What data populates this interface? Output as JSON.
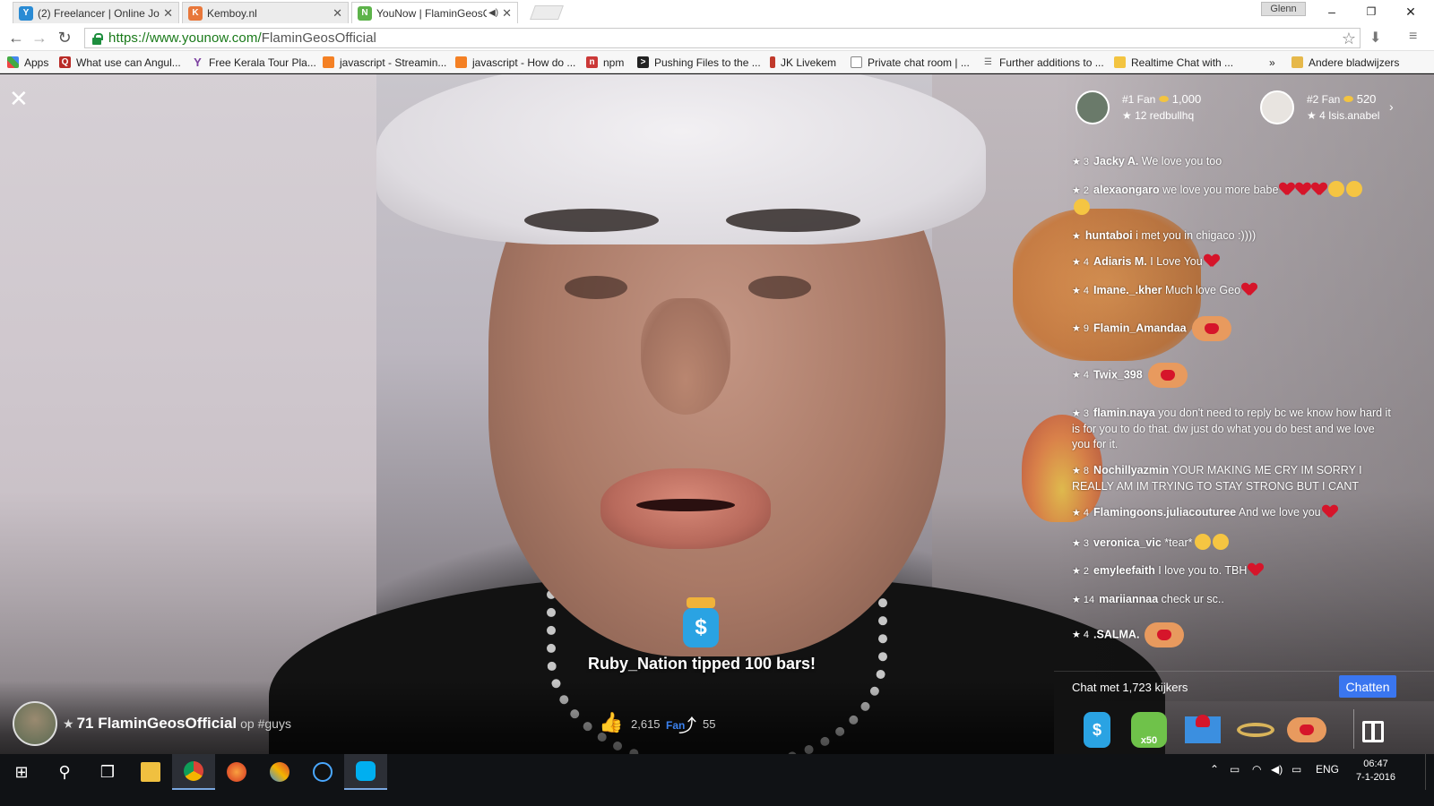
{
  "browser": {
    "tabs": [
      {
        "label": "(2) Freelancer | Online Job",
        "favicon": "freelancer-icon",
        "active": false
      },
      {
        "label": "Kemboy.nl",
        "favicon": "kemboy-icon",
        "active": false
      },
      {
        "label": "YouNow | FlaminGeosO",
        "favicon": "younow-icon",
        "active": true
      }
    ],
    "user_label": "Glenn",
    "window_controls": {
      "minimize": "–",
      "maximize": "❐",
      "close": "✕"
    },
    "url_host": "https://www.younow.com/",
    "url_path": "FlaminGeosOfficial",
    "bookmarks": [
      {
        "label": "Apps",
        "icon": "apps-grid-icon"
      },
      {
        "label": "What use can Angul...",
        "icon": "quora-icon"
      },
      {
        "label": "Free Kerala Tour Pla...",
        "icon": "yahoo-icon"
      },
      {
        "label": "javascript - Streamin...",
        "icon": "stackoverflow-icon"
      },
      {
        "label": "javascript - How do ...",
        "icon": "stackoverflow-icon"
      },
      {
        "label": "npm",
        "icon": "npm-icon"
      },
      {
        "label": "Pushing Files to the ...",
        "icon": "terminal-icon"
      },
      {
        "label": "JK Livekem",
        "icon": "jk-icon"
      },
      {
        "label": "Private chat room | ...",
        "icon": "document-icon"
      },
      {
        "label": "Further additions to ...",
        "icon": "list-icon"
      },
      {
        "label": "Realtime Chat with ...",
        "icon": "folder-page-icon"
      }
    ],
    "bookmarks_overflow": "»",
    "other_bookmarks": "Andere bladwijzers"
  },
  "stream": {
    "close_label": "✕",
    "fans": [
      {
        "rank_label": "#1 Fan",
        "bars": "1,000",
        "level_name": "★ 12 redbullhq"
      },
      {
        "rank_label": "#2 Fan",
        "bars": "520",
        "level_name": "★ 4 Isis.anabel"
      }
    ],
    "chat": [
      {
        "level": "★ 3",
        "user": "Jacky A.",
        "text": " We love you too",
        "extras": ""
      },
      {
        "level": "★ 2",
        "user": "alexaongaro",
        "text": " we love you more babe",
        "extras": "hearts-kiss"
      },
      {
        "level": "★",
        "user": "huntaboi",
        "text": " i met you in chigaco :))))",
        "extras": ""
      },
      {
        "level": "★ 4",
        "user": "Adiaris M.",
        "text": " I Love You",
        "extras": "heart"
      },
      {
        "level": "★ 4",
        "user": "Imane._.kher",
        "text": " Much love Geo",
        "extras": "heart"
      },
      {
        "level": "★ 9",
        "user": "Flamin_Amandaa",
        "text": "",
        "extras": "hands"
      },
      {
        "level": "★ 4",
        "user": "Twix_398",
        "text": "",
        "extras": "hands"
      },
      {
        "level": "★ 3",
        "user": "flamin.naya",
        "text": " you don't need to reply bc we know how hard it is for you to do that. dw just do what you do best and we love you for it.",
        "extras": ""
      },
      {
        "level": "★ 8",
        "user": "Nochillyazmin",
        "text": " YOUR MAKING ME CRY IM SORRY I REALLY AM IM TRYING TO STAY STRONG BUT I CANT",
        "extras": ""
      },
      {
        "level": "★ 4",
        "user": "Flamingoons.juliacouturee",
        "text": " And we love you",
        "extras": "heart"
      },
      {
        "level": "★ 3",
        "user": "veronica_vic",
        "text": " *tear*",
        "extras": "cry"
      },
      {
        "level": "★ 2",
        "user": "emyleefaith",
        "text": " I love you to. TBH",
        "extras": "heart"
      },
      {
        "level": "★ 14",
        "user": "mariiannaa",
        "text": " check ur sc..",
        "extras": ""
      },
      {
        "level": "★ 4",
        "user": ".SALMA.",
        "text": "",
        "extras": "hands"
      }
    ],
    "viewers_label": "Chat met 1,723 kijkers",
    "chat_button": "Chatten",
    "gifts": [
      {
        "name": "tip-jar-gift",
        "label": "$"
      },
      {
        "name": "thumbs-up-gift",
        "label": "x50"
      },
      {
        "name": "love-letter-gift",
        "label": ""
      },
      {
        "name": "ring-gift",
        "label": ""
      },
      {
        "name": "heart-hands-gift",
        "label": ""
      }
    ],
    "tip": {
      "jar_symbol": "$",
      "message": "Ruby_Nation tipped 100 bars!"
    },
    "broadcaster": {
      "star": "★",
      "name": "71 FlaminGeosOfficial",
      "tag": "op #guys"
    },
    "likes": "2,615",
    "fan_label": "Fan",
    "shares": "55"
  },
  "taskbar": {
    "lang": "ENG",
    "time": "06:47",
    "date": "7-1-2016"
  },
  "colors": {
    "chat_button": "#3a76f0",
    "fan_label": "#3b82f0",
    "bars": "#f3c440",
    "url_secure": "#1a7a1a"
  }
}
